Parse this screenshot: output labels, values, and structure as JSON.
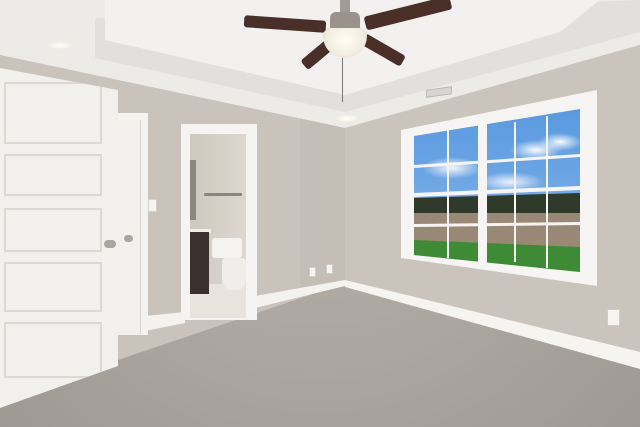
{
  "scene": {
    "kind": "empty bedroom interior photograph",
    "colors": {
      "wall": "#c9c3bc",
      "ceiling": "#ecebe8",
      "carpet": "#aba59f",
      "trim": "#f4f3f0",
      "fan_blade": "#4a2f28",
      "vanity": "#3a312c",
      "sky": "#3f86d6",
      "grass": "#3f8a35"
    },
    "icons": {
      "door_handle": "door-handle-icon",
      "light_switch": "light-switch-icon",
      "outlet": "outlet-icon",
      "fan": "ceiling-fan-icon"
    }
  }
}
